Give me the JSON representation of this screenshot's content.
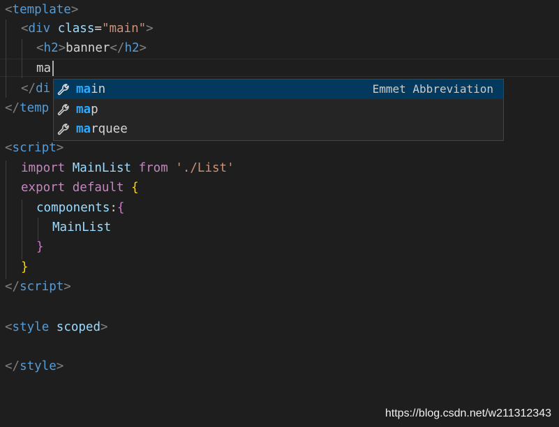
{
  "editor": {
    "lines": {
      "l1": {
        "open": "<",
        "tag": "template",
        "close": ">"
      },
      "l2": {
        "open": "<",
        "tag": "div",
        "attr": "class",
        "eq": "=",
        "value": "\"main\"",
        "close": ">"
      },
      "l3": {
        "open": "<",
        "tag": "h2",
        "close": ">",
        "text": "banner",
        "open2": "</",
        "tag2": "h2",
        "close2": ">"
      },
      "l4": {
        "text": "ma"
      },
      "l5": {
        "open": "</",
        "tag": "di"
      },
      "l6": {
        "open": "</",
        "tag": "temp"
      },
      "l8": {
        "open": "<",
        "tag": "script",
        "close": ">"
      },
      "l9": {
        "kw1": "import",
        "ident": "MainList",
        "kw2": "from",
        "str": "'./List'"
      },
      "l10": {
        "kw1": "export",
        "kw2": "default",
        "brace": "{"
      },
      "l11": {
        "ident": "components",
        "colon": ":",
        "brace": "{"
      },
      "l12": {
        "ident": "MainList"
      },
      "l13": {
        "brace": "}"
      },
      "l14": {
        "brace": "}"
      },
      "l15": {
        "open": "</",
        "tag": "script",
        "close": ">"
      },
      "l17": {
        "open": "<",
        "tag": "style",
        "attr": "scoped",
        "close": ">"
      },
      "l19": {
        "open": "</",
        "tag": "style",
        "close": ">"
      }
    }
  },
  "suggest": {
    "items": [
      {
        "match": "ma",
        "rest": "in",
        "detail": "Emmet Abbreviation",
        "icon": "wrench-icon"
      },
      {
        "match": "ma",
        "rest": "p",
        "icon": "wrench-icon"
      },
      {
        "match": "ma",
        "rest": "rquee",
        "icon": "wrench-icon"
      }
    ]
  },
  "watermark": "https://blog.csdn.net/w211312343",
  "colors": {
    "background": "#1e1e1e",
    "tag": "#569cd6",
    "attribute": "#9cdcfe",
    "string": "#ce9178",
    "keyword": "#c586c0",
    "match_highlight": "#2aaaff",
    "selected_suggestion": "#04395e"
  }
}
